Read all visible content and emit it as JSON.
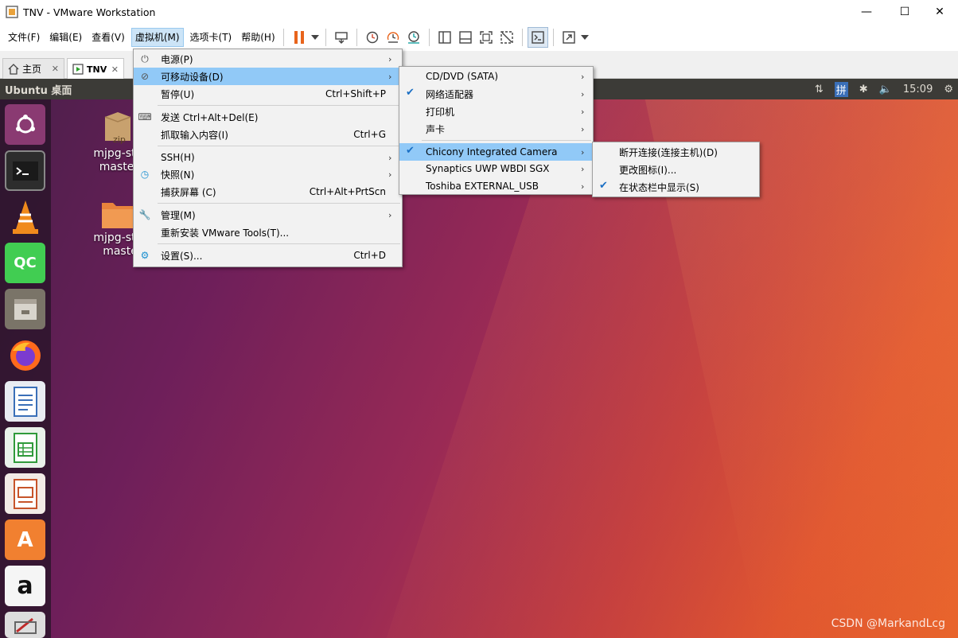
{
  "window": {
    "title": "TNV - VMware Workstation",
    "controls": {
      "minimize": "—",
      "maximize": "☐",
      "close": "✕"
    }
  },
  "menubar": {
    "items": [
      {
        "label": "文件(F)"
      },
      {
        "label": "编辑(E)"
      },
      {
        "label": "查看(V)"
      },
      {
        "label": "虚拟机(M)"
      },
      {
        "label": "选项卡(T)"
      },
      {
        "label": "帮助(H)"
      }
    ]
  },
  "toolbar": {
    "icons": [
      "pause-icon",
      "dropdown-arrow-icon",
      "send-ctrl-alt-del-icon",
      "snapshot-take-icon",
      "snapshot-revert-icon",
      "snapshot-manager-icon",
      "view-sidebar-icon",
      "view-thumbnail-icon",
      "view-fullscreen-icon",
      "view-unity-icon",
      "console-icon",
      "stretch-icon"
    ],
    "pause_color": "#e8641c"
  },
  "tabs": [
    {
      "label": "主页",
      "close": "✕"
    },
    {
      "label": "TNV",
      "close": "✕"
    }
  ],
  "guest": {
    "panel_title": "Ubuntu 桌面",
    "tray": {
      "ime": "拼",
      "time": "15:09"
    },
    "desktop_icons": [
      {
        "line1": "mjpg-stre",
        "line2": "master.",
        "badge": "zip"
      },
      {
        "line1": "mjpg-stre",
        "line2": "maste"
      }
    ],
    "launcher_icons": [
      "ubuntu-dash-icon",
      "terminal-icon",
      "vlc-icon",
      "qt-creator-icon",
      "files-icon",
      "firefox-icon",
      "writer-icon",
      "calc-icon",
      "impress-icon",
      "software-center-icon",
      "amazon-icon",
      "settings-icon"
    ],
    "qc_label": "QC",
    "amazon_label": "a",
    "software_label": "A"
  },
  "vm_menu": {
    "items": [
      {
        "icon": "power-icon",
        "label": "电源(P)",
        "shortcut": "",
        "arrow": "›"
      },
      {
        "icon": "removable-device-icon",
        "label": "可移动设备(D)",
        "shortcut": "",
        "arrow": "›"
      },
      {
        "icon": "",
        "label": "暂停(U)",
        "shortcut": "Ctrl+Shift+P",
        "arrow": ""
      },
      {
        "icon": "send-keys-icon",
        "label": "发送 Ctrl+Alt+Del(E)",
        "shortcut": "",
        "arrow": ""
      },
      {
        "icon": "",
        "label": "抓取输入内容(I)",
        "shortcut": "Ctrl+G",
        "arrow": ""
      },
      {
        "icon": "",
        "label": "SSH(H)",
        "shortcut": "",
        "arrow": "›"
      },
      {
        "icon": "snapshot-icon",
        "label": "快照(N)",
        "shortcut": "",
        "arrow": "›"
      },
      {
        "icon": "",
        "label": "捕获屏幕 (C)",
        "shortcut": "Ctrl+Alt+PrtScn",
        "arrow": ""
      },
      {
        "icon": "wrench-icon",
        "label": "管理(M)",
        "shortcut": "",
        "arrow": "›"
      },
      {
        "icon": "",
        "label": "重新安装 VMware Tools(T)...",
        "shortcut": "",
        "arrow": ""
      },
      {
        "icon": "settings-icon",
        "label": "设置(S)...",
        "shortcut": "Ctrl+D",
        "arrow": ""
      }
    ]
  },
  "devices_menu": {
    "items": [
      {
        "checked": false,
        "label": "CD/DVD (SATA)",
        "arrow": "›"
      },
      {
        "checked": true,
        "label": "网络适配器",
        "arrow": "›"
      },
      {
        "checked": false,
        "label": "打印机",
        "arrow": "›"
      },
      {
        "checked": false,
        "label": "声卡",
        "arrow": "›"
      },
      {
        "checked": true,
        "label": "Chicony Integrated Camera",
        "arrow": "›"
      },
      {
        "checked": false,
        "label": "Synaptics UWP WBDI SGX",
        "arrow": "›"
      },
      {
        "checked": false,
        "label": "Toshiba EXTERNAL_USB",
        "arrow": "›"
      }
    ],
    "check_glyph": "✔"
  },
  "camera_menu": {
    "items": [
      {
        "checked": false,
        "label": "断开连接(连接主机)(D)"
      },
      {
        "checked": false,
        "label": "更改图标(I)..."
      },
      {
        "checked": true,
        "label": "在状态栏中显示(S)"
      }
    ]
  },
  "watermark": "CSDN @MarkandLcg"
}
